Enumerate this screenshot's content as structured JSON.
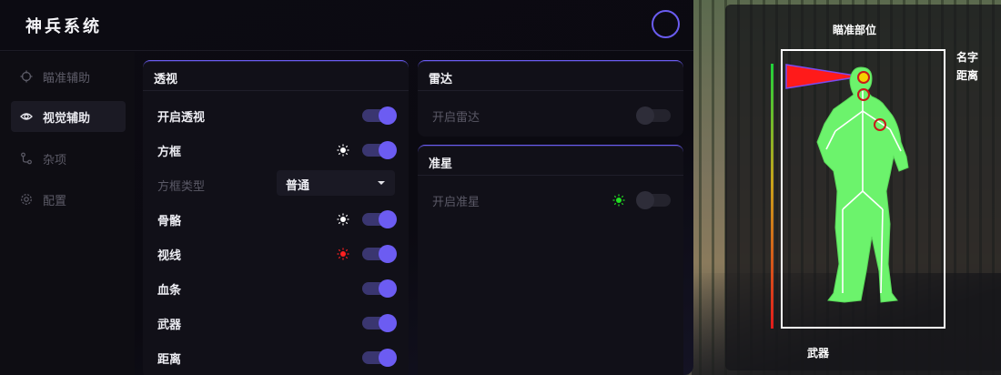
{
  "app": {
    "title": "神兵系统"
  },
  "sidebar": {
    "items": [
      {
        "label": "瞄准辅助",
        "icon": "crosshair-icon",
        "active": false
      },
      {
        "label": "视觉辅助",
        "icon": "eye-icon",
        "active": true
      },
      {
        "label": "杂项",
        "icon": "misc-icon",
        "active": false
      },
      {
        "label": "配置",
        "icon": "gear-icon",
        "active": false
      }
    ]
  },
  "esp": {
    "title": "透视",
    "enable_label": "开启透视",
    "box_label": "方框",
    "box_type_label": "方框类型",
    "box_type_value": "普通",
    "skeleton_label": "骨骼",
    "sightline_label": "视线",
    "health_label": "血条",
    "weapon_label": "武器",
    "distance_label": "距离"
  },
  "radar": {
    "title": "雷达",
    "enable_label": "开启雷达"
  },
  "crosshair": {
    "title": "准星",
    "enable_label": "开启准星"
  },
  "preview": {
    "aim_part_label": "瞄准部位",
    "name_label": "名字",
    "distance_label": "距离",
    "weapon_label": "武器"
  },
  "colors": {
    "accent": "#6c5cf2",
    "box_color": "#ffffff",
    "skeleton_color": "#ffffff",
    "sightline_color": "#ff2020",
    "crosshair_color": "#22e022",
    "body_fill": "#6cf36c"
  }
}
